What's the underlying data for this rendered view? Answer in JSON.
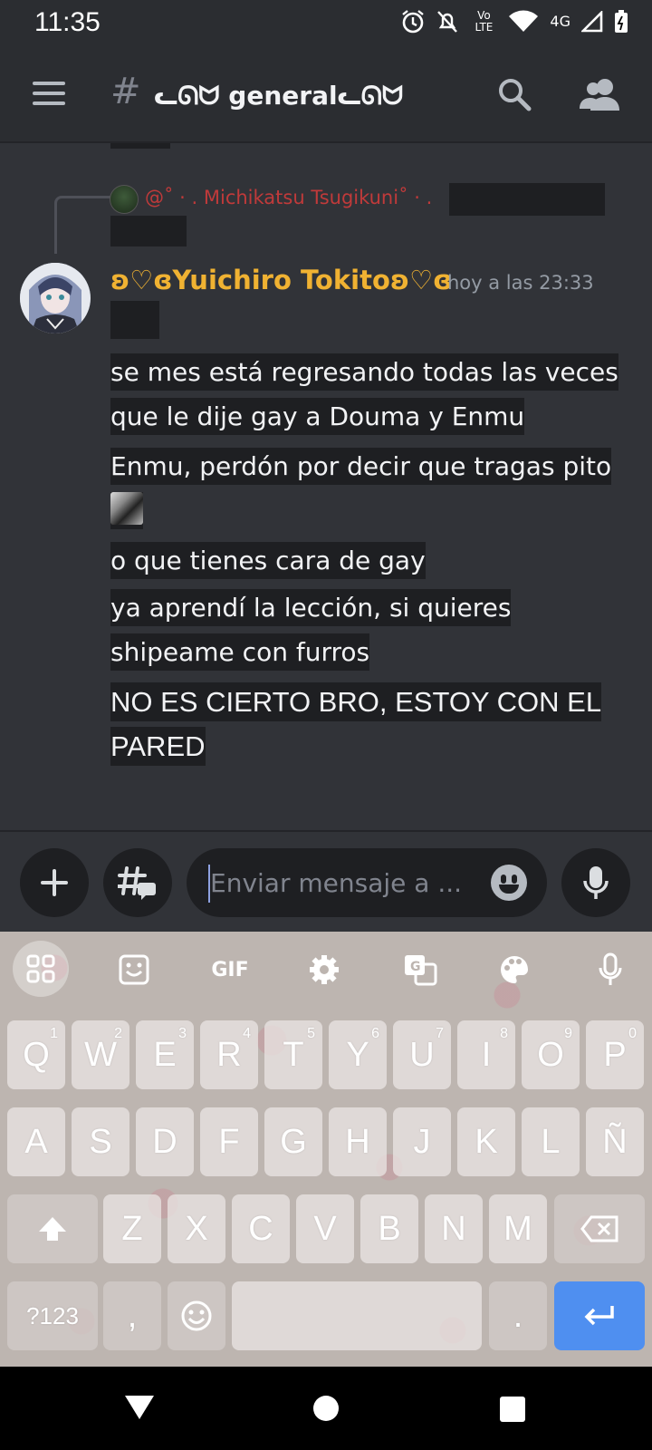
{
  "status_bar": {
    "time": "11:35",
    "network": "4G",
    "volte": "Vo LTE"
  },
  "header": {
    "hash": "#",
    "channel_name": "ᓚᘏᗢ generalᓚᘏᗢ"
  },
  "reply": {
    "author": "@˚ · . Michikatsu Tsugikuni˚ · ."
  },
  "message": {
    "author": "ʚ♡ɞYuichiro Tokitoʚ♡ɞ",
    "timestamp": "hoy a las 23:33",
    "lines": [
      "se mes está regresando todas las veces que le dije gay a Douma y Enmu",
      "Enmu, perdón por decir que tragas pito",
      "o que tienes cara de gay",
      "ya aprendí la lección, si quieres shipeame con furros",
      "NO ES CIERTO BRO, ESTOY CON EL PARED"
    ]
  },
  "composer": {
    "placeholder": "Enviar mensaje a ..."
  },
  "keyboard": {
    "toolbar": {
      "gif": "GIF"
    },
    "row1": [
      "Q",
      "W",
      "E",
      "R",
      "T",
      "Y",
      "U",
      "I",
      "O",
      "P"
    ],
    "row1_hints": [
      "1",
      "2",
      "3",
      "4",
      "5",
      "6",
      "7",
      "8",
      "9",
      "0"
    ],
    "row2": [
      "A",
      "S",
      "D",
      "F",
      "G",
      "H",
      "J",
      "K",
      "L",
      "Ñ"
    ],
    "row3": [
      "Z",
      "X",
      "C",
      "V",
      "B",
      "N",
      "M"
    ],
    "symbols": "?123",
    "comma": ",",
    "period": "."
  },
  "colors": {
    "accent_username": "#f0b232",
    "reply_name": "#c03a3a",
    "enter_key": "#4f8ff0"
  }
}
